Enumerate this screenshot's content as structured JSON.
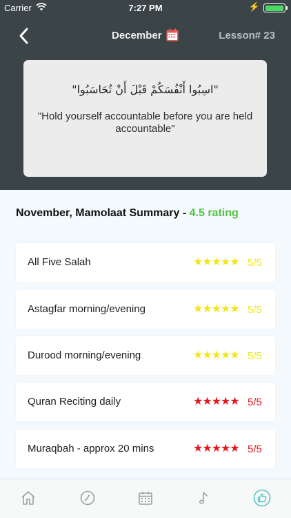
{
  "status_bar": {
    "carrier": "Carrier",
    "time": "7:27 PM"
  },
  "nav": {
    "title": "December",
    "lesson": "Lesson# 23"
  },
  "quote": {
    "arabic": "\"اسِبُوا أَنْفُسَكُمْ قَبْلَ أَنْ تُحَاسَبُوا\"",
    "translation": "\"Hold yourself accountable before you are held accountable\""
  },
  "summary": {
    "title": "November, Mamolaat Summary",
    "separator": " - ",
    "rating": "4.5 rating"
  },
  "items": [
    {
      "label": "All Five Salah",
      "stars": "★★★★★",
      "score": "5/5",
      "color": "#f2e51b"
    },
    {
      "label": "Astagfar morning/evening",
      "stars": "★★★★★",
      "score": "5/5",
      "color": "#f2e51b"
    },
    {
      "label": "Durood morning/evening",
      "stars": "★★★★★",
      "score": "5/5",
      "color": "#f2e51b"
    },
    {
      "label": "Quran Reciting daily",
      "stars": "★★★★★",
      "score": "5/5",
      "color": "#e8161c"
    },
    {
      "label": "Muraqbah - approx 20 mins",
      "stars": "★★★★★",
      "score": "5/5",
      "color": "#e8161c"
    }
  ],
  "colors": {
    "header_bg": "#3b4447",
    "rating_green": "#53c244",
    "star_yellow": "#f2e51b",
    "star_red": "#e8161c",
    "tab_active": "#5cc4c4"
  },
  "tabs": [
    {
      "icon": "home-icon",
      "active": false
    },
    {
      "icon": "clock-icon",
      "active": false
    },
    {
      "icon": "calendar-icon",
      "active": false
    },
    {
      "icon": "music-note-icon",
      "active": false
    },
    {
      "icon": "thumbs-up-icon",
      "active": true
    }
  ]
}
